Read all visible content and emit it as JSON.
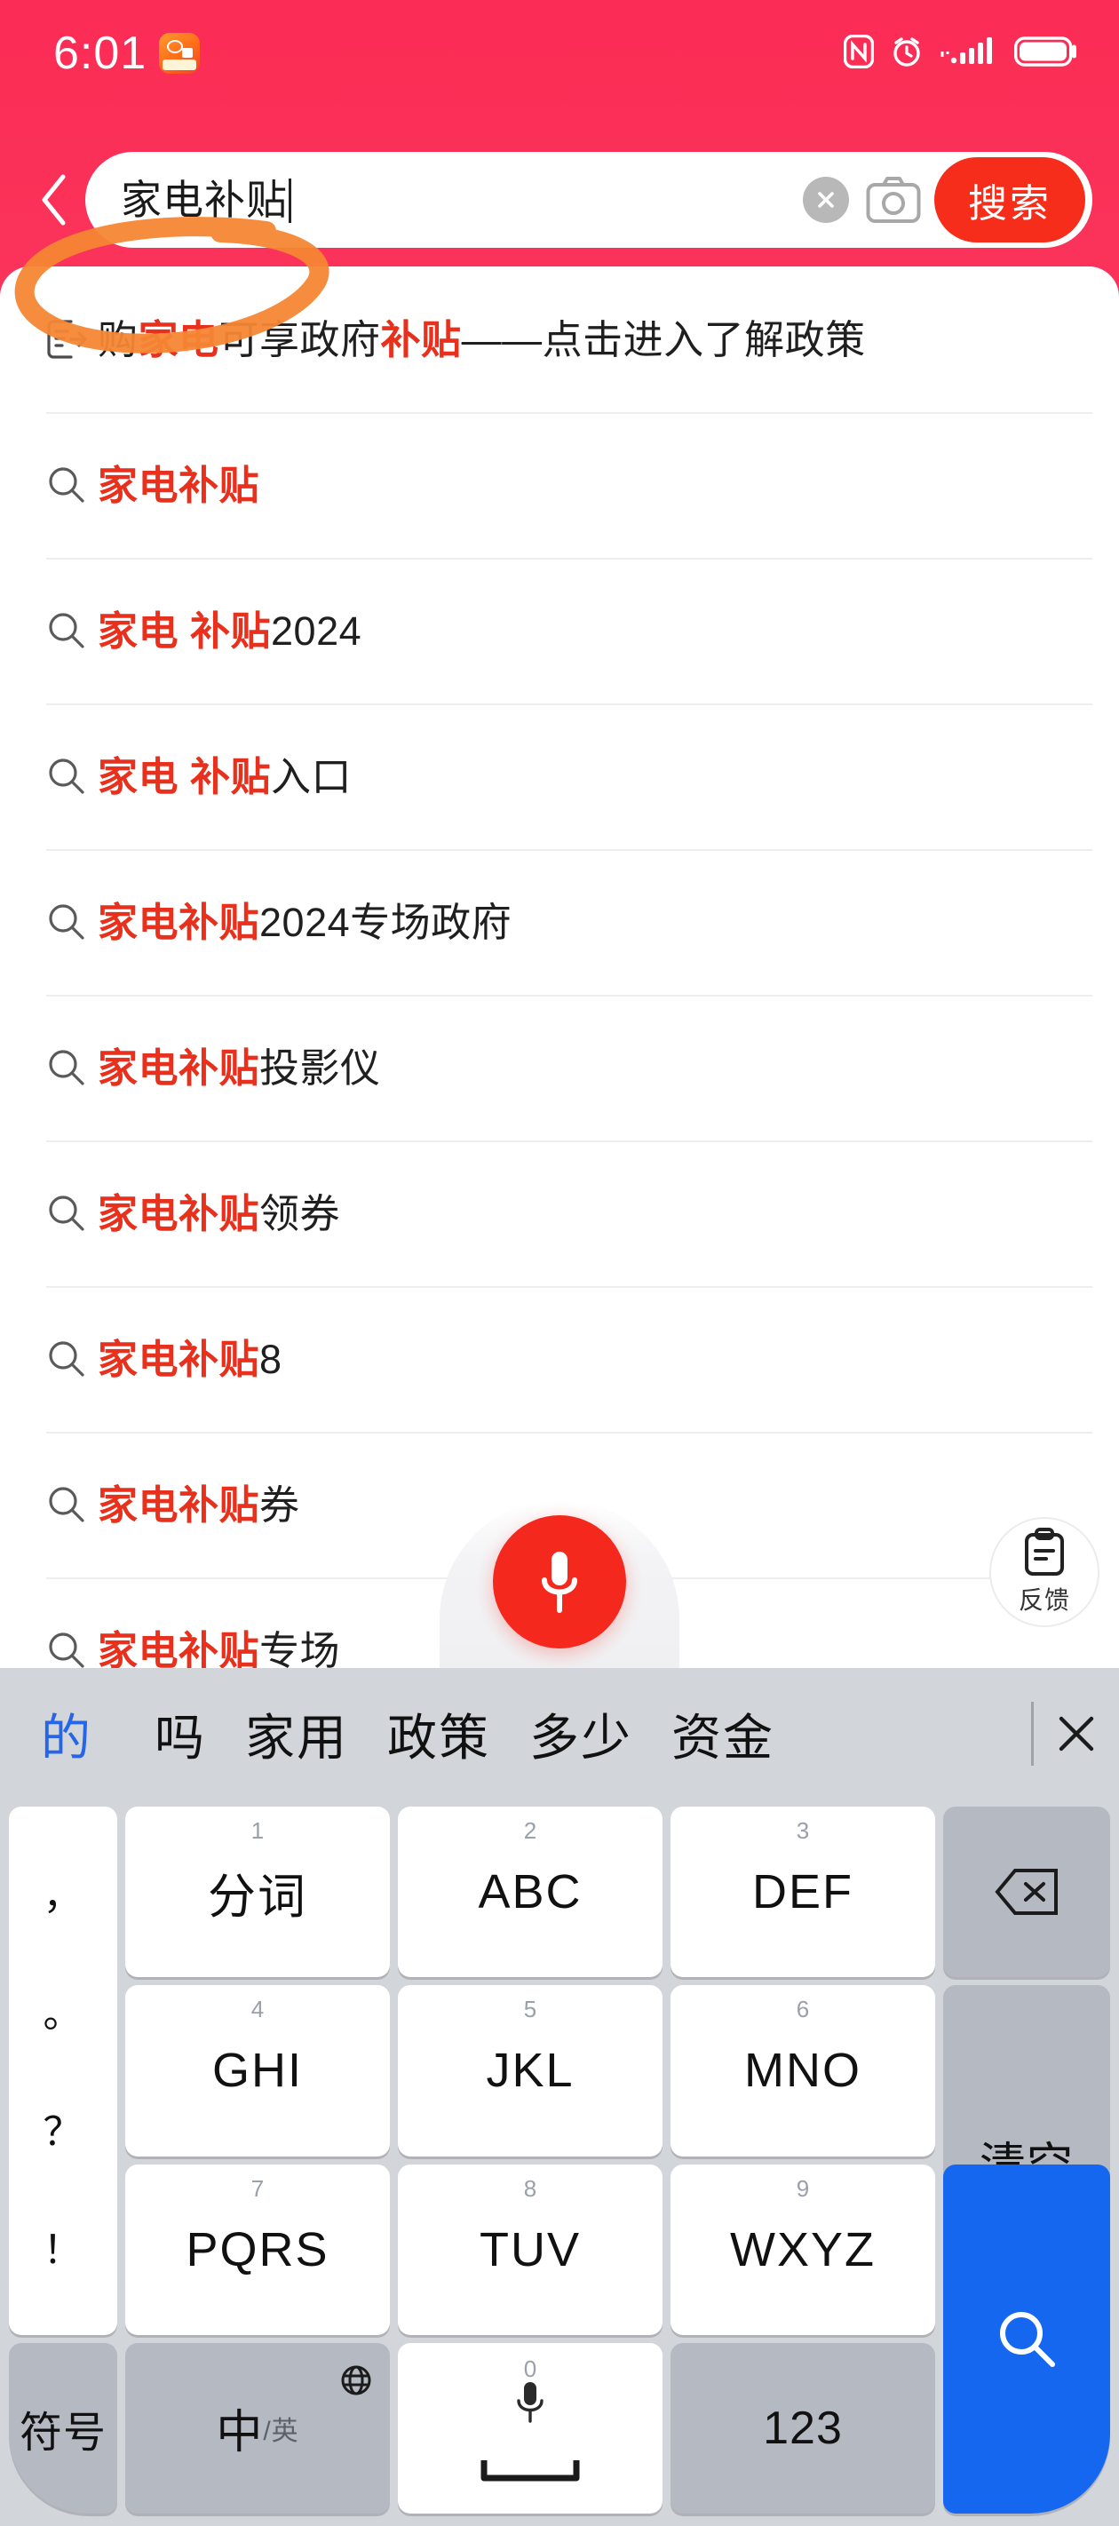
{
  "status_bar": {
    "time": "6:01",
    "app_icon_name": "video-app-icon",
    "icons": [
      "nfc-icon",
      "alarm-icon",
      "signal-icon",
      "battery-icon"
    ]
  },
  "search_header": {
    "back_label": "back-chevron",
    "query": "家电补贴",
    "clear_label": "×",
    "camera_label": "camera-icon",
    "submit_label": "搜索",
    "submit_color": "#f72d1b"
  },
  "suggestions": {
    "highlight_color": "#e8301c",
    "items": [
      {
        "icon": "document-link-icon",
        "segments": [
          {
            "t": "购",
            "hl": false
          },
          {
            "t": "家电",
            "hl": true
          },
          {
            "t": "可享政府",
            "hl": false
          },
          {
            "t": "补贴",
            "hl": true
          },
          {
            "t": "——点击进入了解政策",
            "hl": false
          }
        ]
      },
      {
        "icon": "search-icon",
        "segments": [
          {
            "t": "家电补贴",
            "hl": true
          }
        ]
      },
      {
        "icon": "search-icon",
        "segments": [
          {
            "t": "家电 补贴",
            "hl": true
          },
          {
            "t": "2024",
            "hl": false
          }
        ]
      },
      {
        "icon": "search-icon",
        "segments": [
          {
            "t": "家电 补贴",
            "hl": true
          },
          {
            "t": "入口",
            "hl": false
          }
        ]
      },
      {
        "icon": "search-icon",
        "segments": [
          {
            "t": "家电补贴",
            "hl": true
          },
          {
            "t": "2024专场政府",
            "hl": false
          }
        ]
      },
      {
        "icon": "search-icon",
        "segments": [
          {
            "t": "家电补贴",
            "hl": true
          },
          {
            "t": "投影仪",
            "hl": false
          }
        ]
      },
      {
        "icon": "search-icon",
        "segments": [
          {
            "t": "家电补贴",
            "hl": true
          },
          {
            "t": "领券",
            "hl": false
          }
        ]
      },
      {
        "icon": "search-icon",
        "segments": [
          {
            "t": "家电补贴",
            "hl": true
          },
          {
            "t": "8",
            "hl": false
          }
        ]
      },
      {
        "icon": "search-icon",
        "segments": [
          {
            "t": "家电补贴",
            "hl": true
          },
          {
            "t": "券",
            "hl": false
          }
        ]
      },
      {
        "icon": "search-icon",
        "segments": [
          {
            "t": "家电补贴",
            "hl": true
          },
          {
            "t": "专场",
            "hl": false
          }
        ]
      }
    ]
  },
  "floating": {
    "voice_icon": "microphone-icon",
    "voice_color": "#f5281d",
    "feedback_icon": "clipboard-icon",
    "feedback_label": "反馈"
  },
  "keyboard": {
    "candidates": [
      "的",
      "吗",
      "家用",
      "政策",
      "多少",
      "资金"
    ],
    "candidate_active_color": "#2566e8",
    "close_label": "close-icon",
    "punct_key": [
      "，",
      "。",
      "？",
      "！"
    ],
    "keys": [
      {
        "num": "1",
        "main": "分词"
      },
      {
        "num": "2",
        "main": "ABC"
      },
      {
        "num": "3",
        "main": "DEF"
      },
      {
        "num": "4",
        "main": "GHI"
      },
      {
        "num": "5",
        "main": "JKL"
      },
      {
        "num": "6",
        "main": "MNO"
      },
      {
        "num": "7",
        "main": "PQRS"
      },
      {
        "num": "8",
        "main": "TUV"
      },
      {
        "num": "9",
        "main": "WXYZ"
      }
    ],
    "backspace_label": "backspace-icon",
    "clear_label": "清空",
    "search_label": "search-icon",
    "symbol_label": "符号",
    "lang_main": "中",
    "lang_sub": "/英",
    "space_num": "0",
    "space_icon": "microphone-icon",
    "num_label": "123",
    "search_key_color": "#1667f0"
  }
}
